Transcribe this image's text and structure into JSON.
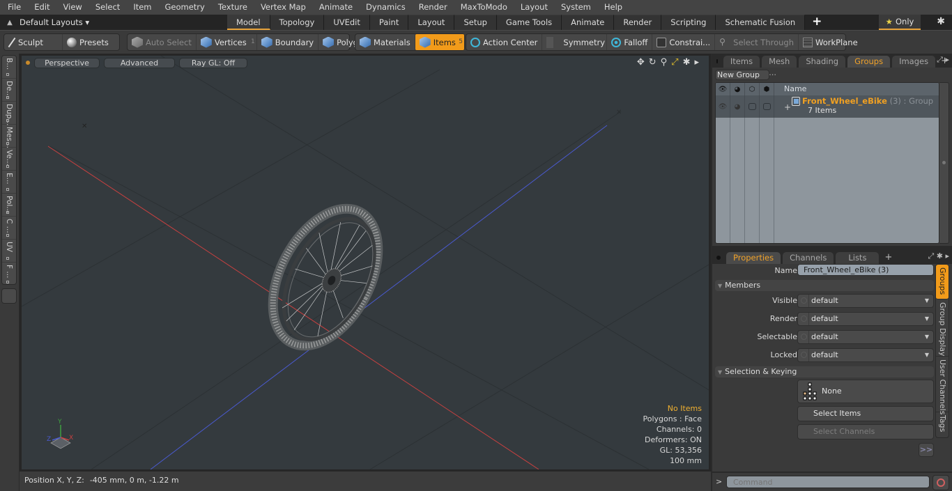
{
  "menu": [
    "File",
    "Edit",
    "View",
    "Select",
    "Item",
    "Geometry",
    "Texture",
    "Vertex Map",
    "Animate",
    "Dynamics",
    "Render",
    "MaxToModo",
    "Layout",
    "System",
    "Help"
  ],
  "layouts": {
    "label": "Default Layouts ▾",
    "tabs": [
      "Model",
      "Topology",
      "UVEdit",
      "Paint",
      "Layout",
      "Setup",
      "Game Tools",
      "Animate",
      "Render",
      "Scripting",
      "Schematic Fusion"
    ],
    "active_tab": "Model",
    "add": "+",
    "only_label": "Only",
    "star": "★"
  },
  "toolbar": {
    "sculpt": "Sculpt",
    "presets": "Presets",
    "auto_select": "Auto Select",
    "vertices": "Vertices",
    "vertices_count": "1",
    "boundary": "Boundary",
    "polygons": "Polygons",
    "materials": "Materials",
    "items": "Items",
    "items_count": "5",
    "action_center": "Action Center",
    "symmetry": "Symmetry",
    "falloff": "Falloff",
    "constraints": "Constrai...",
    "select_through": "Select Through",
    "workplane": "WorkPlane"
  },
  "left_tabs": [
    "B...",
    "De...",
    "Dup...",
    "Mes...",
    "Ve...",
    "E...",
    "Pol...",
    "C ...",
    "UV",
    "F ..."
  ],
  "viewport": {
    "view": "Perspective",
    "shading": "Advanced",
    "raygl": "Ray GL: Off",
    "info": {
      "selection": "No Items",
      "mode": "Polygons : Face",
      "channels": "Channels: 0",
      "deformers": "Deformers: ON",
      "gl": "GL: 53,356",
      "scale": "100 mm"
    },
    "axis": {
      "x": "X",
      "y": "Y",
      "z": "Z"
    },
    "colors": {
      "x_axis": "#c84040",
      "z_axis": "#4a5ad0",
      "accent": "#f29b1a"
    }
  },
  "status": {
    "label": "Position X, Y, Z:",
    "value": "-405 mm, 0 m, -1.22 m"
  },
  "top_panel": {
    "tabs": [
      "Items",
      "Mesh ...",
      "Shading",
      "Groups",
      "Images"
    ],
    "active_tab": "Groups",
    "new_group": "New Group",
    "column_name": "Name",
    "groups": [
      {
        "name": "Front_Wheel_eBike",
        "count": "(3)",
        "type": ": Group",
        "sub": "7 Items"
      }
    ]
  },
  "bottom_panel": {
    "tabs": [
      "Properties",
      "Channels",
      "Lists"
    ],
    "active_tab": "Properties",
    "name_label": "Name",
    "name_value": "Front_Wheel_eBike (3)",
    "members_label": "Members",
    "fields": [
      {
        "label": "Visible",
        "value": "default"
      },
      {
        "label": "Render",
        "value": "default"
      },
      {
        "label": "Selectable",
        "value": "default"
      },
      {
        "label": "Locked",
        "value": "default"
      }
    ],
    "sel_keying_label": "Selection & Keying",
    "none_label": "None",
    "select_items": "Select Items",
    "select_channels": "Select Channels",
    "more": ">>",
    "side_tabs": [
      "Groups",
      "Group Display",
      "User Channels",
      "Tags"
    ]
  },
  "command": {
    "prompt": ">",
    "placeholder": "Command"
  }
}
